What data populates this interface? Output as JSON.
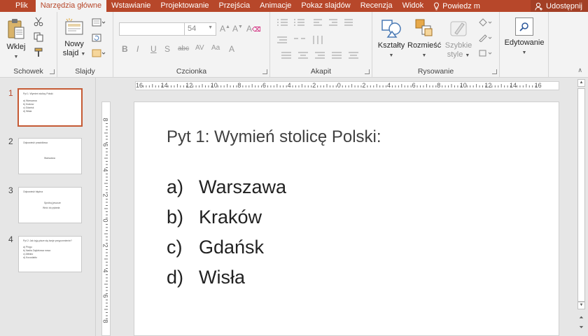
{
  "menu": {
    "tabs": [
      {
        "label": "Plik"
      },
      {
        "label": "Narzędzia główne",
        "active": true
      },
      {
        "label": "Wstawianie"
      },
      {
        "label": "Projektowanie"
      },
      {
        "label": "Przejścia"
      },
      {
        "label": "Animacje"
      },
      {
        "label": "Pokaz slajdów"
      },
      {
        "label": "Recenzja"
      },
      {
        "label": "Widok"
      }
    ],
    "tell_me": "Powiedz m",
    "share": "Udostępnij"
  },
  "ribbon": {
    "clipboard": {
      "label": "Schowek",
      "paste": "Wklej"
    },
    "slides": {
      "label": "Slajdy",
      "new_line1": "Nowy",
      "new_line2": "slajd"
    },
    "font": {
      "label": "Czcionka",
      "name": "",
      "size": "54"
    },
    "paragraph": {
      "label": "Akapit"
    },
    "drawing": {
      "label": "Rysowanie",
      "shapes": "Kształty",
      "arrange": "Rozmieść",
      "quick1": "Szybkie",
      "quick2": "style"
    },
    "editing": {
      "label": "Edytowanie"
    }
  },
  "thumbnails": [
    {
      "num": "1",
      "lines": [
        "Pyt 1: Wymień stolicę Polski:",
        "a)  Warszawa",
        "b)  Kraków",
        "c)  Gdańsk",
        "d)  Wisła"
      ]
    },
    {
      "num": "2",
      "lines": [
        "Odpowiedź prawidłowa",
        "Warszawa"
      ]
    },
    {
      "num": "3",
      "lines": [
        "Odpowiedź błędna",
        "Spróbuj jeszcze",
        "Wróć do pytania"
      ]
    },
    {
      "num": "4",
      "lines": [
        "Pyt 2: Jak żyją pisze się twoje przypomnienie?",
        "a)  Pingu",
        "b)  Nadia Zajdzkowa nowa",
        "c)  Alfrabo",
        "d)  Kocodablo"
      ]
    }
  ],
  "ruler": {
    "h": [
      "16",
      "14",
      "12",
      "10",
      "8",
      "6",
      "4",
      "2",
      "0",
      "2",
      "4",
      "6",
      "8",
      "10",
      "12",
      "14",
      "16"
    ],
    "v": [
      "8",
      "6",
      "4",
      "2",
      "0",
      "2",
      "4",
      "6",
      "8"
    ]
  },
  "slide": {
    "title": "Pyt 1: Wymień stolicę Polski:",
    "options": [
      {
        "letter": "a)",
        "text": "Warszawa"
      },
      {
        "letter": "b)",
        "text": "Kraków"
      },
      {
        "letter": "c)",
        "text": "Gdańsk"
      },
      {
        "letter": "d)",
        "text": "Wisła"
      }
    ]
  },
  "colors": {
    "accent": "#b7472a",
    "selection": "#c55a34"
  }
}
